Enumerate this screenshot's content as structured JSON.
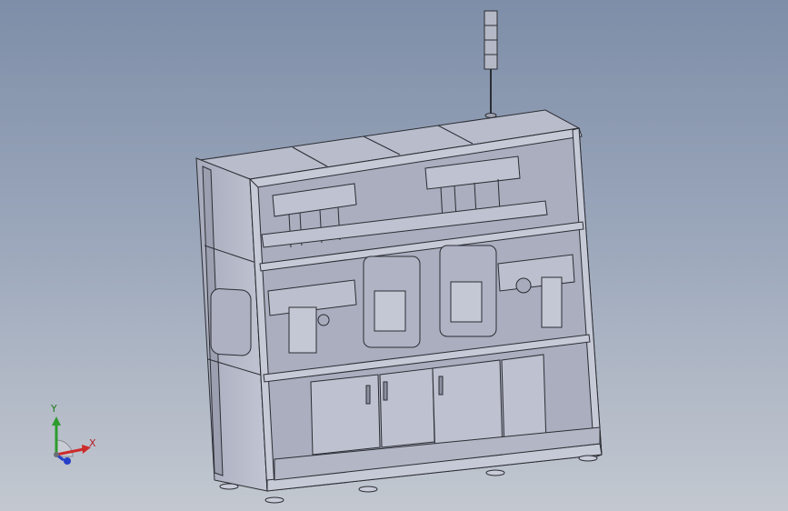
{
  "viewport": {
    "background_top": "#7e8ea8",
    "background_bottom": "#c3c8d0",
    "model_fill": "#b7bacb",
    "model_edge": "#2b2d33"
  },
  "triad": {
    "x_label": "X",
    "y_label": "Y",
    "x_color": "#cc2b2b",
    "y_color": "#2d9c2d",
    "z_color": "#2440c8"
  }
}
